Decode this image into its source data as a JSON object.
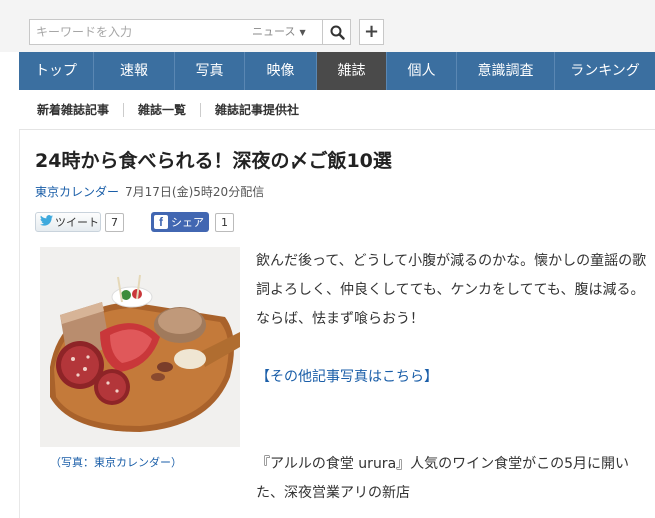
{
  "search": {
    "placeholder": "キーワードを入力",
    "scope": "ニュース",
    "submit_icon": "search-icon",
    "add_icon": "plus-icon"
  },
  "nav": {
    "items": [
      {
        "label": "トップ"
      },
      {
        "label": "速報"
      },
      {
        "label": "写真"
      },
      {
        "label": "映像"
      },
      {
        "label": "雑誌"
      },
      {
        "label": "個人"
      },
      {
        "label": "意識調査"
      },
      {
        "label": "ランキング"
      }
    ],
    "active": "雑誌",
    "colors": {
      "bar": "#3b6fa0",
      "active": "#4a4a4a"
    }
  },
  "subnav": {
    "items": [
      {
        "label": "新着雑誌記事"
      },
      {
        "label": "雑誌一覧"
      },
      {
        "label": "雑誌記事提供社"
      }
    ]
  },
  "article": {
    "title": "24時から食べられる！深夜の〆ご飯10選",
    "source": "東京カレンダー",
    "published": "7月17日(金)5時20分配信",
    "share": {
      "tweet_label": "ツイート",
      "tweet_count": "7",
      "fb_label": "シェア",
      "fb_count": "1"
    },
    "photo_caption": "（写真：東京カレンダー）",
    "paragraph1": "飲んだ後って、どうして小腹が減るのかな。懐かしの童謡の歌詞よろしく、仲良くしてても、ケンカをしてても、腹は減る。ならば、怯まず喰らおう！",
    "more_link": "【その他記事写真はこちら】",
    "paragraph2": "『アルルの食堂 urura』人気のワイン食堂がこの5月に開いた、深夜営業アリの新店"
  }
}
